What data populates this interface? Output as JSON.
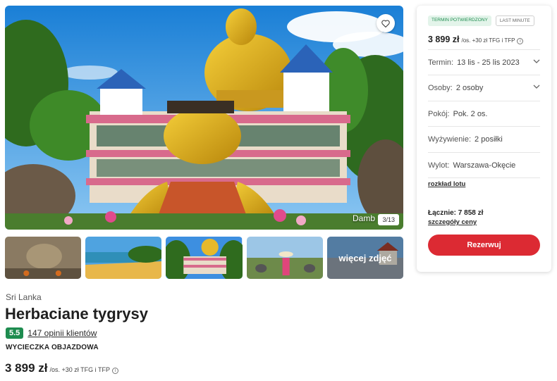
{
  "gallery": {
    "caption": "Damb",
    "counter": "3/13",
    "more_label": "więcej zdjęć"
  },
  "offer": {
    "country": "Sri Lanka",
    "title": "Herbaciane tygrysy",
    "rating": "5.5",
    "reviews_link": "147 opinii klientów",
    "trip_type": "WYCIECZKA OBJAZDOWA",
    "price": "3 899 zł",
    "price_suffix": "/os. +30 zł TFG i TFP"
  },
  "booking": {
    "badge_confirmed": "TERMIN POTWIERDZONY",
    "badge_lastminute": "LAST MINUTE",
    "price": "3 899 zł",
    "price_suffix": "/os. +30 zł TFG i TFP",
    "term_label": "Termin:",
    "term_value": "13 lis - 25 lis 2023",
    "persons_label": "Osoby:",
    "persons_value": "2 osoby",
    "room_label": "Pokój:",
    "room_value": "Pok. 2 os.",
    "board_label": "Wyżywienie:",
    "board_value": "2 posiłki",
    "departure_label": "Wylot:",
    "departure_value": "Warszawa-Okęcie",
    "flight_schedule_link": "rozkład lotu",
    "total": "Łącznie: 7 858 zł",
    "price_details_link": "szczegóły ceny",
    "reserve_button": "Rezerwuj"
  },
  "colors": {
    "accent_red": "#dc2a33",
    "rating_green": "#1e8c4f",
    "confirmed_bg": "#e3f4ea"
  },
  "icons": [
    "heart-icon",
    "chevron-down-icon",
    "info-icon"
  ]
}
